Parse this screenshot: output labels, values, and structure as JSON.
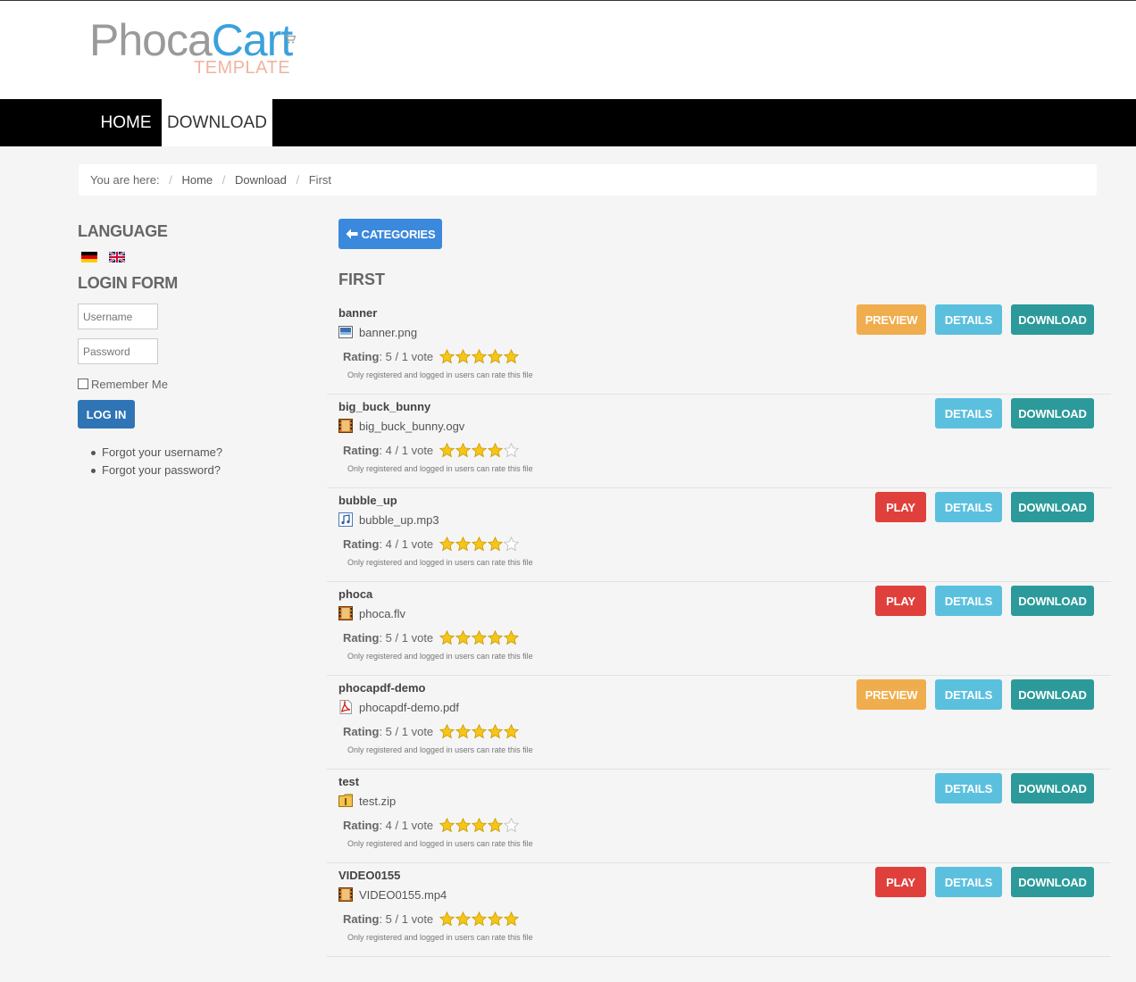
{
  "logo": {
    "part1": "Phoca",
    "part2": "Cart",
    "sub": "TEMPLATE"
  },
  "nav": {
    "home": "HOME",
    "download": "DOWNLOAD"
  },
  "breadcrumb": {
    "prefix": "You are here:",
    "items": [
      "Home",
      "Download",
      "First"
    ]
  },
  "sidebar": {
    "language_title": "LANGUAGE",
    "login_title": "LOGIN FORM",
    "username_placeholder": "Username",
    "password_placeholder": "Password",
    "remember_label": "Remember Me",
    "login_button": "LOG IN",
    "links": [
      "Forgot your username?",
      "Forgot your password?"
    ]
  },
  "main": {
    "categories_button": "CATEGORIES",
    "category_title": "FIRST",
    "rating_label": "Rating",
    "note": "Only registered and logged in users can rate this file",
    "labels": {
      "preview": "PREVIEW",
      "play": "PLAY",
      "details": "DETAILS",
      "download": "DOWNLOAD"
    },
    "files": [
      {
        "title": "banner",
        "filename": "banner.png",
        "icon": "image-file-icon",
        "rating": 5,
        "rating_text": ": 5 / 1 vote",
        "action": "preview"
      },
      {
        "title": "big_buck_bunny",
        "filename": "big_buck_bunny.ogv",
        "icon": "video-file-icon",
        "rating": 4,
        "rating_text": ": 4 / 1 vote",
        "action": ""
      },
      {
        "title": "bubble_up",
        "filename": "bubble_up.mp3",
        "icon": "audio-file-icon",
        "rating": 4,
        "rating_text": ": 4 / 1 vote",
        "action": "play"
      },
      {
        "title": "phoca",
        "filename": "phoca.flv",
        "icon": "video-file-icon",
        "rating": 5,
        "rating_text": ": 5 / 1 vote",
        "action": "play"
      },
      {
        "title": "phocapdf-demo",
        "filename": "phocapdf-demo.pdf",
        "icon": "pdf-file-icon",
        "rating": 5,
        "rating_text": ": 5 / 1 vote",
        "action": "preview"
      },
      {
        "title": "test",
        "filename": "test.zip",
        "icon": "zip-file-icon",
        "rating": 4,
        "rating_text": ": 4 / 1 vote",
        "action": ""
      },
      {
        "title": "VIDEO0155",
        "filename": "VIDEO0155.mp4",
        "icon": "video-file-icon",
        "rating": 5,
        "rating_text": ": 5 / 1 vote",
        "action": "play"
      }
    ]
  },
  "colors": {
    "primary": "#3b89dd",
    "login": "#2f74b5",
    "preview": "#f0ad4e",
    "play": "#e0403c",
    "details": "#5bc0de",
    "download": "#2c9a9a",
    "star": "#f5c518"
  }
}
